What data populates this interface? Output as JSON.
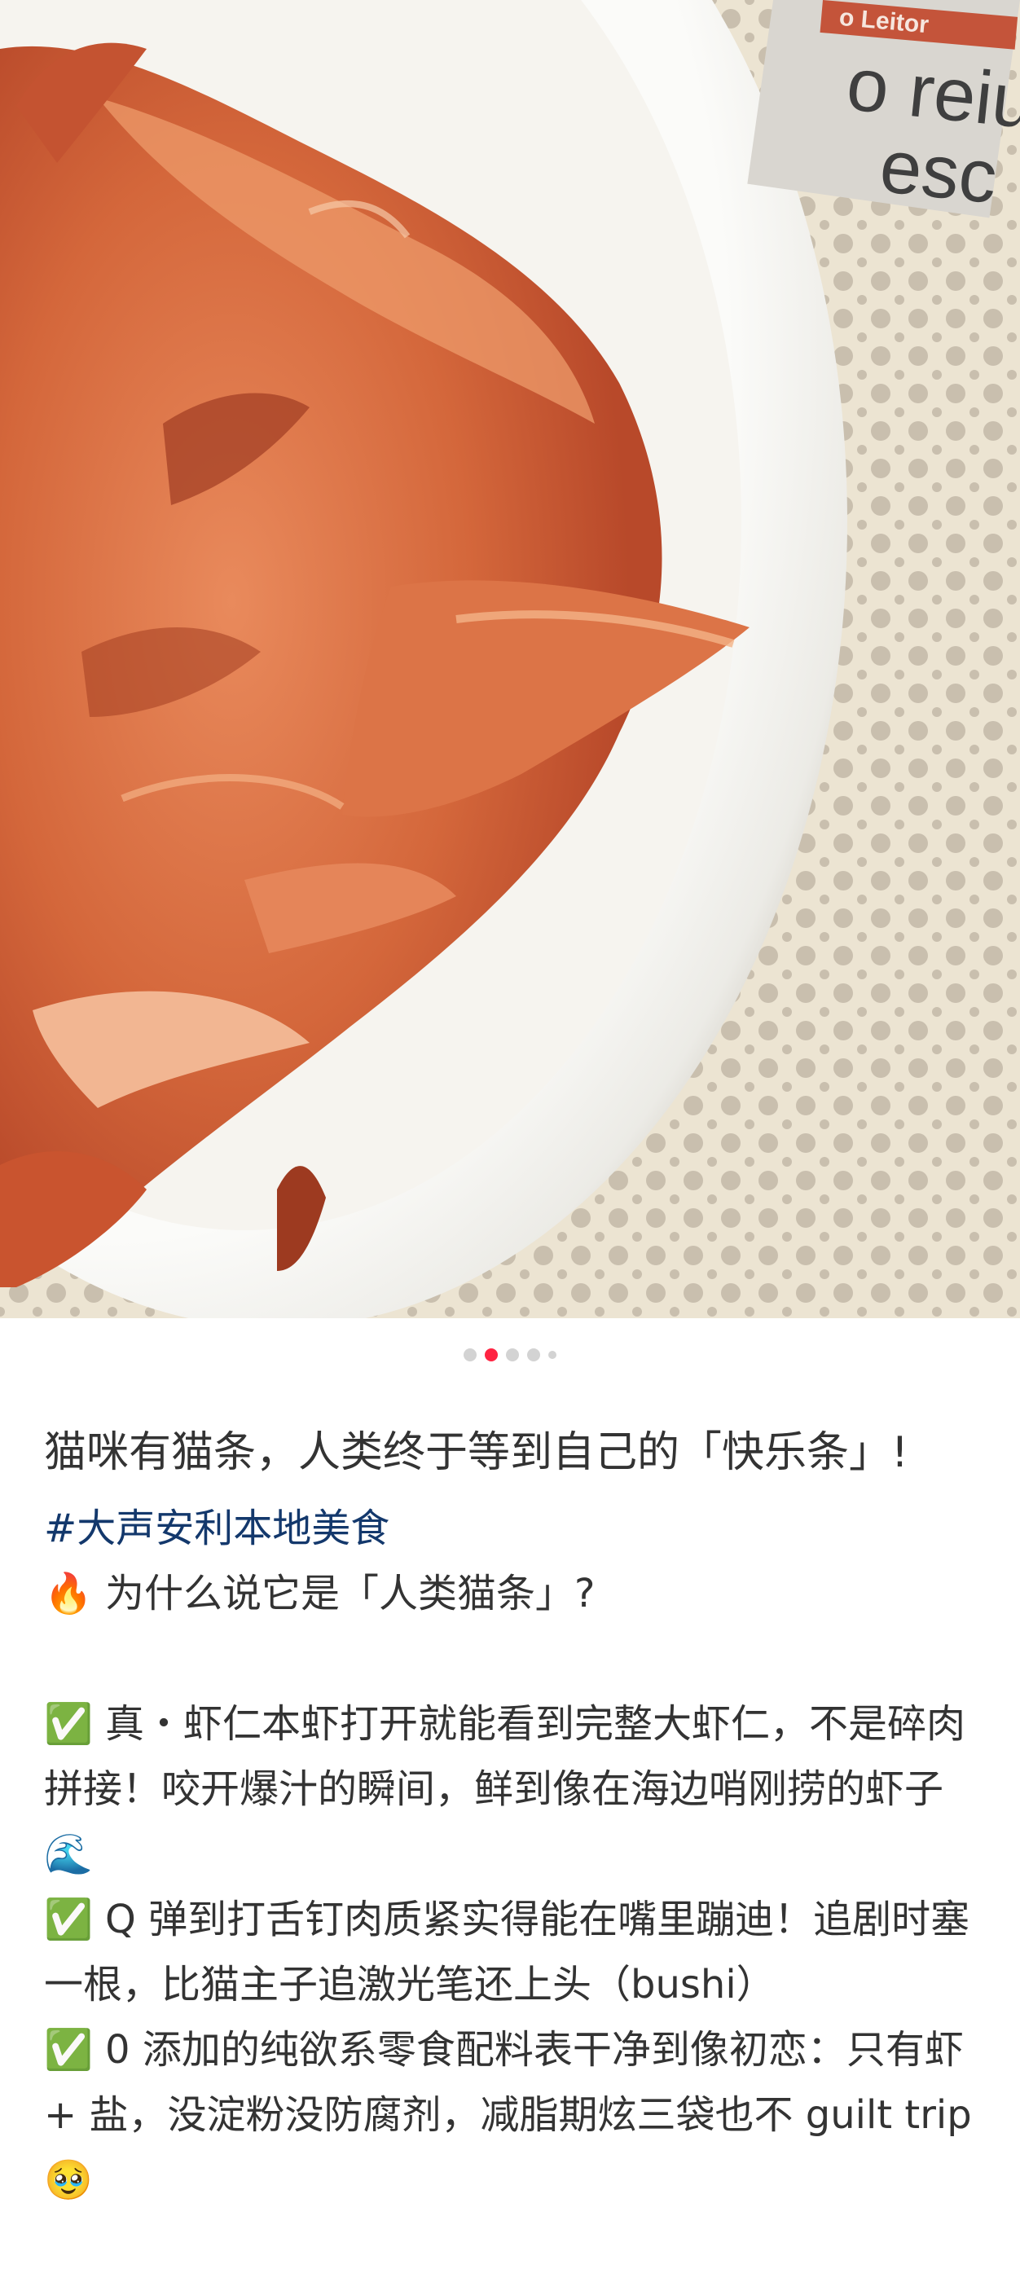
{
  "carousel": {
    "total": 5,
    "active_index": 1
  },
  "photo": {
    "alt_icon": "fried-shrimp-bowl-photo",
    "newspaper_banner": "o Leitor",
    "newspaper_text": "o reius\n  esc"
  },
  "note": {
    "title": "猫咪有猫条，人类终于等到自己的「快乐条」!",
    "hashtag": "#大声安利本地美食",
    "lines": [
      "🔥 为什么说它是「人类猫条」?",
      "",
      "✅ 真・虾仁本虾打开就能看到完整大虾仁，不是碎肉拼接！咬开爆汁的瞬间，鲜到像在海边哨刚捞的虾子🌊",
      "✅ Q 弹到打舌钉肉质紧实得能在嘴里蹦迪！追剧时塞一根，比猫主子追激光笔还上头（bushi）",
      "✅ 0 添加的纯欲系零食配料表干净到像初恋：只有虾 + 盐，没淀粉没防腐剂，减脂期炫三袋也不 guilt trip🥹"
    ]
  },
  "colors": {
    "accent": "#ff2442",
    "hashtag": "#13386c",
    "text": "#333333",
    "dot_inactive": "#d3d3d3"
  }
}
